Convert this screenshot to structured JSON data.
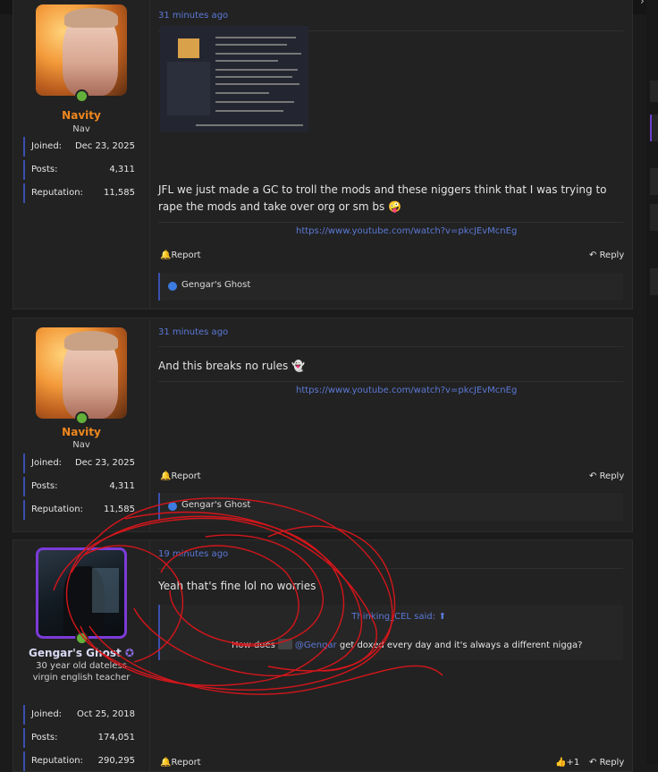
{
  "header": {
    "logo_icon": "site-logo-icon",
    "alert_icon": "alert-icon",
    "nav_icon": "chevron-right-icon"
  },
  "posts": [
    {
      "author": {
        "name": "Navity",
        "title": "Nav",
        "name_color": "#f0871e"
      },
      "stats": [
        {
          "label": "Joined:",
          "value": "Dec 23, 2025"
        },
        {
          "label": "Posts:",
          "value": "4,311"
        },
        {
          "label": "Reputation:",
          "value": "11,585"
        }
      ],
      "time": "31 minutes ago",
      "text": "JFL we just made a GC to troll the mods and these niggers think that I was trying to rape the mods and take over org or sm bs 🤪",
      "link": "https://www.youtube.com/watch?v=pkcJEvMcnEg",
      "report": "Report",
      "reply": "Reply",
      "reactor": "Gengar's Ghost"
    },
    {
      "author": {
        "name": "Navity",
        "title": "Nav",
        "name_color": "#f0871e"
      },
      "stats": [
        {
          "label": "Joined:",
          "value": "Dec 23, 2025"
        },
        {
          "label": "Posts:",
          "value": "4,311"
        },
        {
          "label": "Reputation:",
          "value": "11,585"
        }
      ],
      "time": "31 minutes ago",
      "text": "And this breaks no rules 👻",
      "link": "https://www.youtube.com/watch?v=pkcJEvMcnEg",
      "report": "Report",
      "reply": "Reply",
      "reactor": "Gengar's Ghost"
    },
    {
      "author": {
        "name": "Gengar's Ghost",
        "title": "30 year old dateless virgin english teacher",
        "name_color": "#d9d9f5"
      },
      "stats": [
        {
          "label": "Joined:",
          "value": "Oct 25, 2018"
        },
        {
          "label": "Posts:",
          "value": "174,051"
        },
        {
          "label": "Reputation:",
          "value": "290,295"
        }
      ],
      "time": "19 minutes ago",
      "text": "Yeah that's fine lol no worries",
      "quote": {
        "author": "Thinking_CEL said:",
        "before": "How does",
        "mention": "@Gengar",
        "after": "get doxed every day and it's always a different nigga?"
      },
      "report": "Report",
      "react_count": "+1",
      "reply": "Reply"
    }
  ],
  "colors": {
    "accent": "#5b79d6",
    "online": "#63b13a",
    "stat_border": "#3a4fb0",
    "scribble": "#d4161b"
  }
}
